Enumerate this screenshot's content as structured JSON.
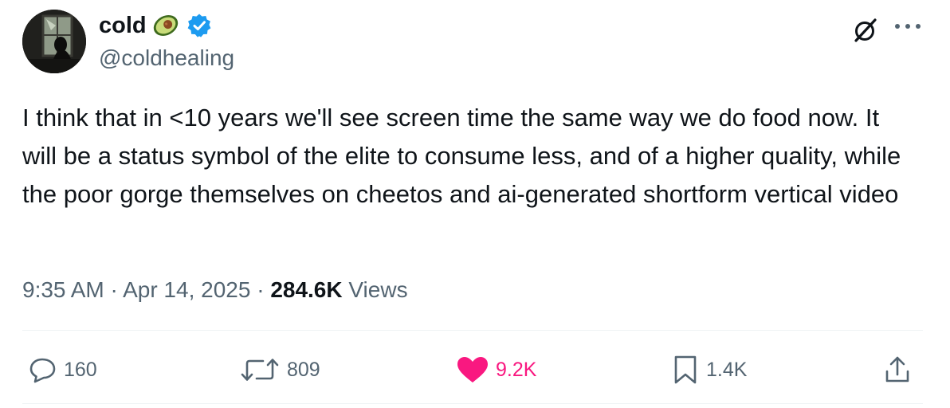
{
  "author": {
    "display_name": "cold",
    "emoji_icon": "avocado-icon",
    "verified_icon": "verified-badge-icon",
    "handle": "@coldhealing"
  },
  "tweet": {
    "text": "I think that in <10 years we'll see screen time the same way we do food now. It will be a status symbol of the elite to consume less, and of a higher quality, while the poor gorge themselves on cheetos and ai-generated shortform vertical video"
  },
  "meta": {
    "time": "9:35 AM",
    "separator": "·",
    "date": "Apr 14, 2025",
    "views_count": "284.6K",
    "views_label": "Views"
  },
  "actions": {
    "replies": "160",
    "reposts": "809",
    "likes": "9.2K",
    "bookmarks": "1.4K"
  },
  "colors": {
    "text": "#0f1419",
    "secondary": "#536471",
    "like": "#f91880",
    "verified": "#1d9bf0",
    "divider": "#eff3f4"
  }
}
